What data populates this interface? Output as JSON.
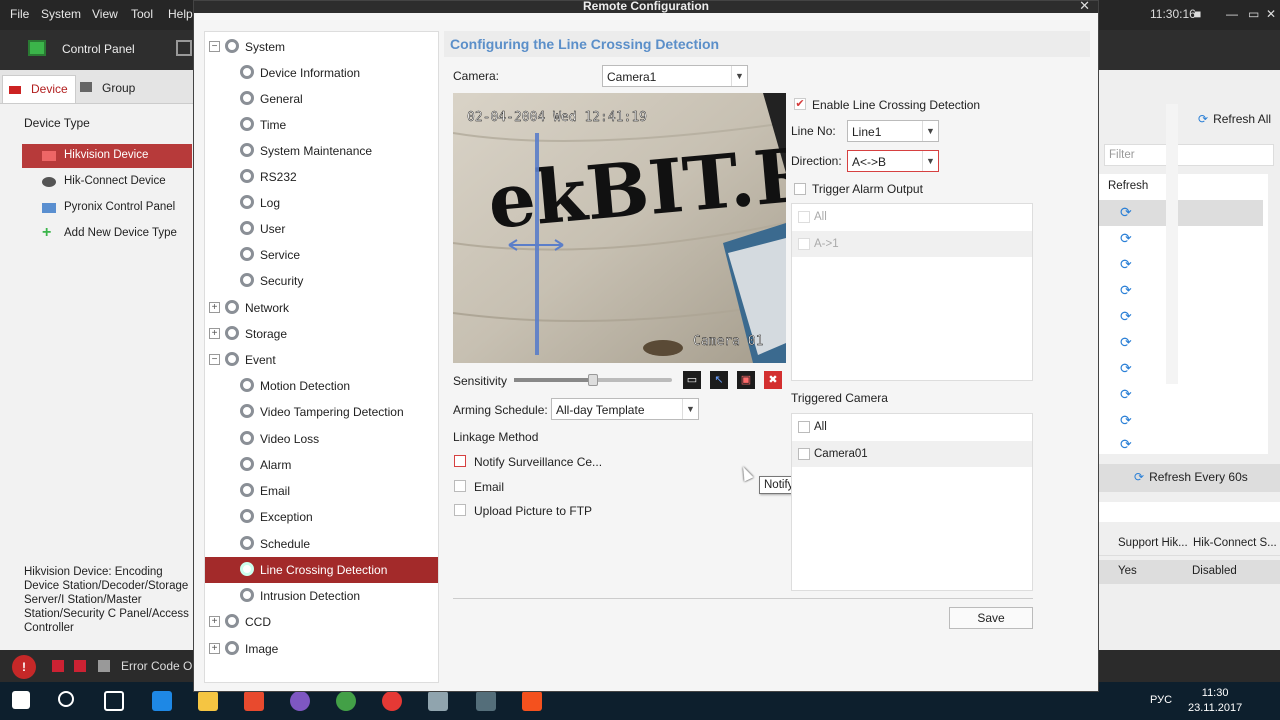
{
  "app": {
    "menus": [
      "File",
      "System",
      "View",
      "Tool",
      "Help"
    ],
    "control_panel_label": "Control Panel",
    "clock": "11:30:16",
    "tabs": {
      "device": "Device",
      "group": "Group"
    },
    "device_type_header": "Device Type",
    "device_types": [
      "Hikvision Device",
      "Hik-Connect Device",
      "Pyronix Control Panel",
      "Add New Device Type"
    ],
    "device_description": "Hikvision Device: Encoding Device Station/Decoder/Storage Server/I Station/Master Station/Security C Panel/Access Controller",
    "refresh_all": "Refresh All",
    "filter_placeholder": "Filter",
    "refresh_col": "Refresh",
    "refresh_every": "Refresh Every 60s",
    "columns": [
      "Support Hik...",
      "Hik-Connect S..."
    ],
    "values": [
      "Yes",
      "Disabled"
    ],
    "status_text": "Error Code Op"
  },
  "taskbar": {
    "time": "11:30",
    "date": "23.11.2017",
    "lang": "РУС"
  },
  "dialog": {
    "title": "Remote Configuration",
    "close": "✕",
    "tree": {
      "system": "System",
      "system_children": [
        "Device Information",
        "General",
        "Time",
        "System Maintenance",
        "RS232",
        "Log",
        "User",
        "Service",
        "Security"
      ],
      "network": "Network",
      "storage": "Storage",
      "event": "Event",
      "event_children": [
        "Motion Detection",
        "Video Tampering Detection",
        "Video Loss",
        "Alarm",
        "Email",
        "Exception",
        "Schedule",
        "Line Crossing Detection",
        "Intrusion Detection"
      ],
      "ccd": "CCD",
      "image": "Image"
    },
    "header": "Configuring the Line Crossing Detection",
    "camera_label": "Camera:",
    "camera_value": "Camera1",
    "osd_time": "02-04-2004 Wed 12:41:19",
    "osd_name": "Camera 01",
    "video_text": "ekBIT.RU",
    "sensitivity_label": "Sensitivity",
    "sensitivity_level": 0.5,
    "arming_label": "Arming Schedule:",
    "arming_value": "All-day Template",
    "linkage_label": "Linkage Method",
    "linkage": [
      "Notify Surveillance Ce...",
      "Email",
      "Upload Picture to FTP"
    ],
    "tooltip": "Notify Surveillance Center",
    "enable_label": "Enable Line Crossing Detection",
    "line_no_label": "Line No:",
    "line_no_value": "Line1",
    "direction_label": "Direction:",
    "direction_value": "A<->B",
    "trigger_alarm_label": "Trigger Alarm Output",
    "alarm_outputs": [
      "All",
      "A->1"
    ],
    "triggered_camera_label": "Triggered Camera",
    "triggered_cameras": [
      "All",
      "Camera01"
    ],
    "save": "Save"
  },
  "colors": {
    "accent_red": "#a32a2a",
    "header_blue": "#5b8fc9",
    "refresh_blue": "#2a7fd6"
  }
}
